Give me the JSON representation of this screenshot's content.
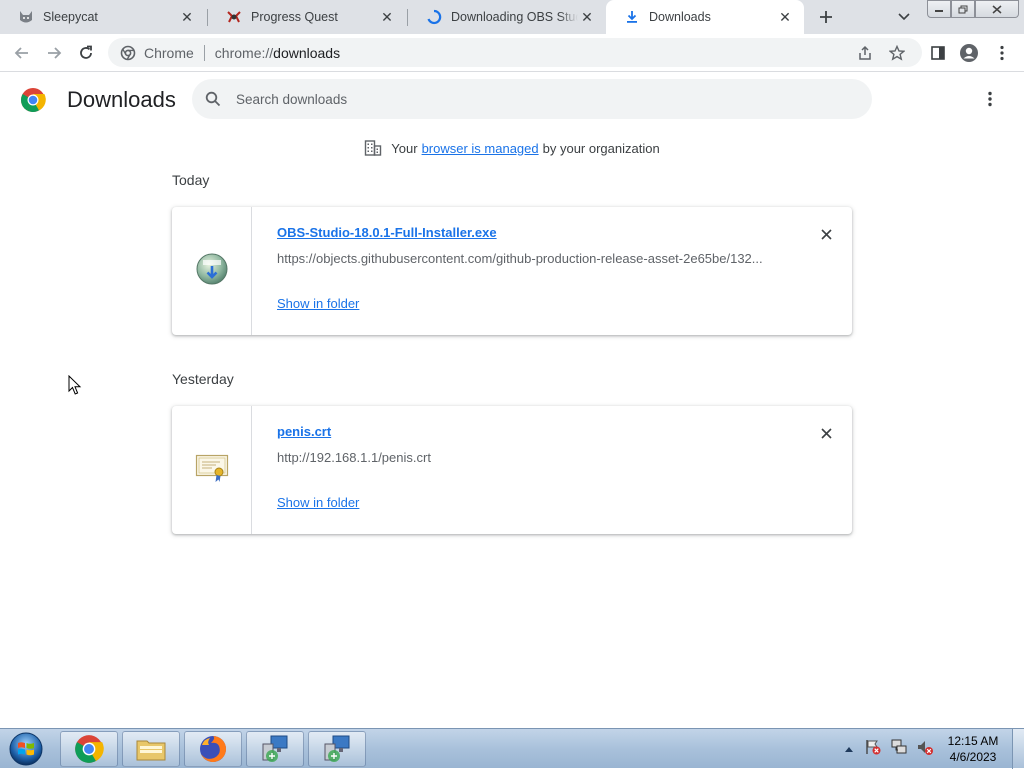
{
  "tabs": [
    {
      "title": "Sleepycat",
      "favicon": "cat-icon",
      "active": false
    },
    {
      "title": "Progress Quest",
      "favicon": "progress-quest-icon",
      "active": false
    },
    {
      "title": "Downloading OBS Studio",
      "favicon": "loading-spinner-icon",
      "active": false
    },
    {
      "title": "Downloads",
      "favicon": "download-icon",
      "active": true
    }
  ],
  "window": {
    "minimize": "minimize-icon",
    "maximize": "restore-icon",
    "close": "close-icon"
  },
  "omnibox": {
    "site_label": "Chrome",
    "url_scheme": "chrome://",
    "url_path": "downloads"
  },
  "downloads_page": {
    "title": "Downloads",
    "search_placeholder": "Search downloads",
    "managed": {
      "prefix": "Your",
      "link": "browser is managed",
      "suffix": "by your organization"
    },
    "groups": [
      {
        "label": "Today",
        "items": [
          {
            "file_name": "OBS-Studio-18.0.1-Full-Installer.exe",
            "url": "https://objects.githubusercontent.com/github-production-release-asset-2e65be/132...",
            "action": "Show in folder",
            "icon": "installer-icon"
          }
        ]
      },
      {
        "label": "Yesterday",
        "items": [
          {
            "file_name": "penis.crt",
            "url": "http://192.168.1.1/penis.crt",
            "action": "Show in folder",
            "icon": "certificate-icon"
          }
        ]
      }
    ]
  },
  "taskbar": {
    "items": [
      "chrome-icon",
      "file-explorer-icon",
      "firefox-icon",
      "network-app-icon",
      "network-app-icon"
    ],
    "clock": {
      "time": "12:15 AM",
      "date": "4/6/2023"
    }
  },
  "colors": {
    "link": "#1a73e8",
    "tabstrip": "#dee1e6",
    "omnibox": "#f1f3f4"
  }
}
